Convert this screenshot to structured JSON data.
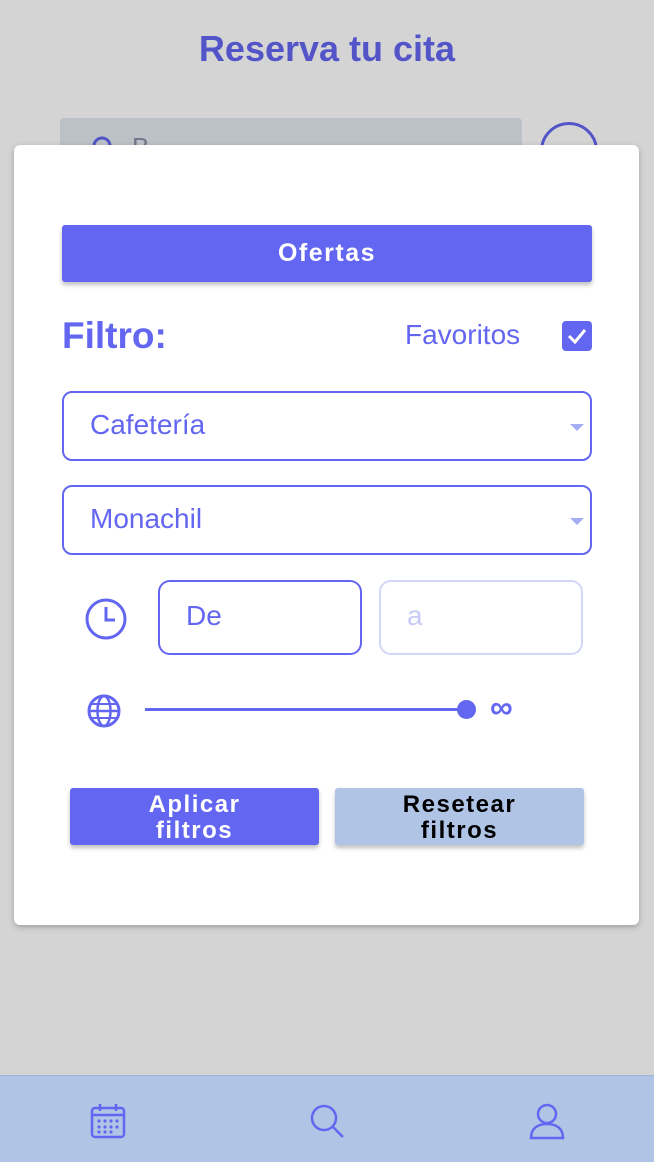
{
  "app": {
    "title": "Reserva tu cita",
    "search_placeholder": "B"
  },
  "modal": {
    "offers_button": "Ofertas",
    "filter_label": "Filtro:",
    "favorites_label": "Favoritos",
    "favorites_checked": true,
    "category_select": {
      "value": "Cafetería"
    },
    "location_select": {
      "value": "Monachil"
    },
    "time_from": {
      "value": "De"
    },
    "time_to": {
      "placeholder": "a"
    },
    "distance_slider": {
      "value_fraction": 1.0,
      "max_label": "∞"
    },
    "apply_button": {
      "line1": "Aplicar",
      "line2": "filtros"
    },
    "reset_button": {
      "line1": "Resetear",
      "line2": "filtros"
    }
  },
  "bottom_nav": {
    "items": [
      "calendar-icon",
      "search-icon",
      "user-icon"
    ]
  },
  "colors": {
    "primary": "#6366f1",
    "secondary": "#b0c4e6",
    "overlay": "#d2d2d2"
  }
}
